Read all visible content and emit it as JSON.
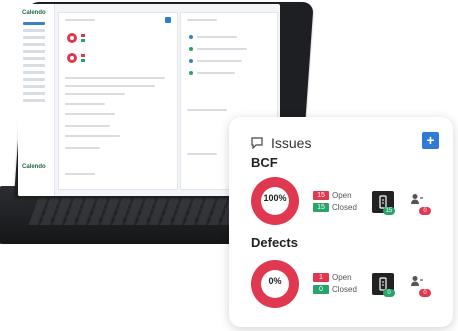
{
  "app": {
    "logo": "Calendo"
  },
  "issues_card": {
    "title": "Issues",
    "add_label": "+",
    "sections": [
      {
        "name": "BCF",
        "percent": "100%",
        "open_count": "15",
        "open_label": "Open",
        "closed_count": "15",
        "closed_label": "Closed",
        "assigned_badge": "15",
        "unassigned_badge": "0"
      },
      {
        "name": "Defects",
        "percent": "0%",
        "open_count": "1",
        "open_label": "Open",
        "closed_count": "0",
        "closed_label": "Closed",
        "assigned_badge": "0",
        "unassigned_badge": "0"
      }
    ]
  },
  "colors": {
    "accent_blue": "#2f7bd6",
    "open_red": "#e0384e",
    "closed_green": "#28a36a"
  },
  "icons": [
    "issues-icon",
    "add-icon",
    "clipboard-icon",
    "person-icon"
  ]
}
